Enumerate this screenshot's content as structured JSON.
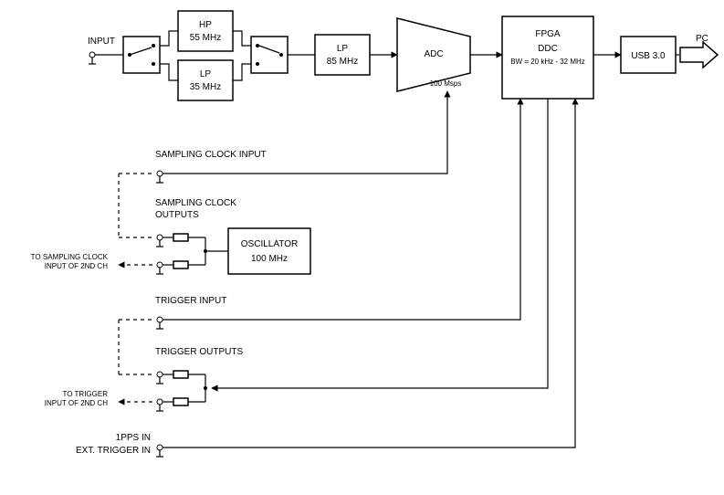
{
  "blocks": {
    "hp": {
      "line1": "HP",
      "line2": "55 MHz"
    },
    "lp35": {
      "line1": "LP",
      "line2": "35 MHz"
    },
    "lp85": {
      "line1": "LP",
      "line2": "85 MHz"
    },
    "adc": {
      "title": "ADC",
      "sub": "100 Msps"
    },
    "fpga": {
      "title": "FPGA",
      "sub1": "DDC",
      "sub2": "BW = 20 kHz - 32 MHz"
    },
    "usb": {
      "title": "USB 3.0"
    },
    "osc": {
      "line1": "OSCILLATOR",
      "line2": "100 MHz"
    }
  },
  "labels": {
    "input": "INPUT",
    "pc": "PC",
    "samp_clk_in": "SAMPLING CLOCK INPUT",
    "samp_clk_out": "SAMPLING CLOCK\nOUTPUTS",
    "to_samp_2nd": "TO SAMPLING CLOCK\nINPUT OF 2ND CH",
    "trig_in": "TRIGGER INPUT",
    "trig_out": "TRIGGER OUTPUTS",
    "to_trig_2nd": "TO TRIGGER\nINPUT OF 2ND CH",
    "pps_in": "1PPS IN",
    "ext_trig_in": "EXT. TRIGGER IN"
  }
}
